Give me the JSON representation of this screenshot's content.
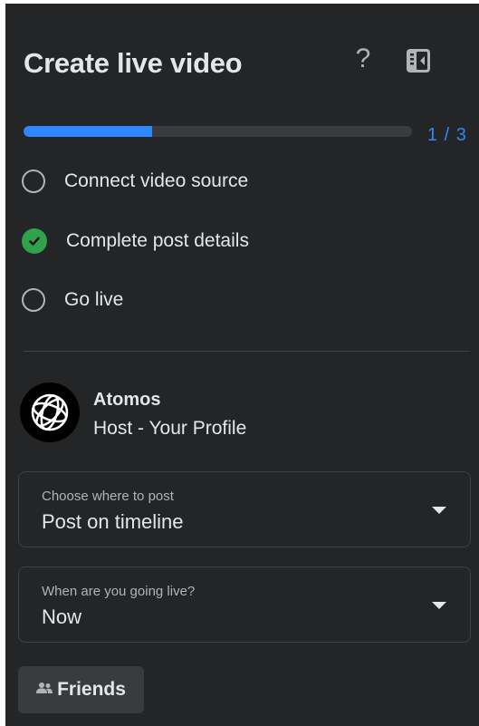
{
  "header": {
    "title": "Create live video",
    "help_symbol": "?",
    "help_icon": "question-mark-icon",
    "panel_icon": "sidebar-panel-icon"
  },
  "progress": {
    "current_step": 1,
    "total_steps": 3,
    "text": "1 / 3",
    "fill_fraction": 0.33,
    "color": "#2d88ff"
  },
  "steps": [
    {
      "label": "Connect video source",
      "status": "incomplete"
    },
    {
      "label": "Complete post details",
      "status": "complete"
    },
    {
      "label": "Go live",
      "status": "incomplete"
    }
  ],
  "host": {
    "name": "Atomos",
    "role": "Host - Your Profile",
    "avatar_icon": "atomos-logo-icon"
  },
  "post_location": {
    "label": "Choose where to post",
    "value": "Post on timeline"
  },
  "go_live_time": {
    "label": "When are you going live?",
    "value": "Now"
  },
  "audience": {
    "label": "Friends",
    "icon": "friends-icon"
  },
  "colors": {
    "background": "#242526",
    "accent": "#2d88ff",
    "success": "#31a24c",
    "text": "#e4e6eb",
    "muted": "#b0b3b8"
  }
}
